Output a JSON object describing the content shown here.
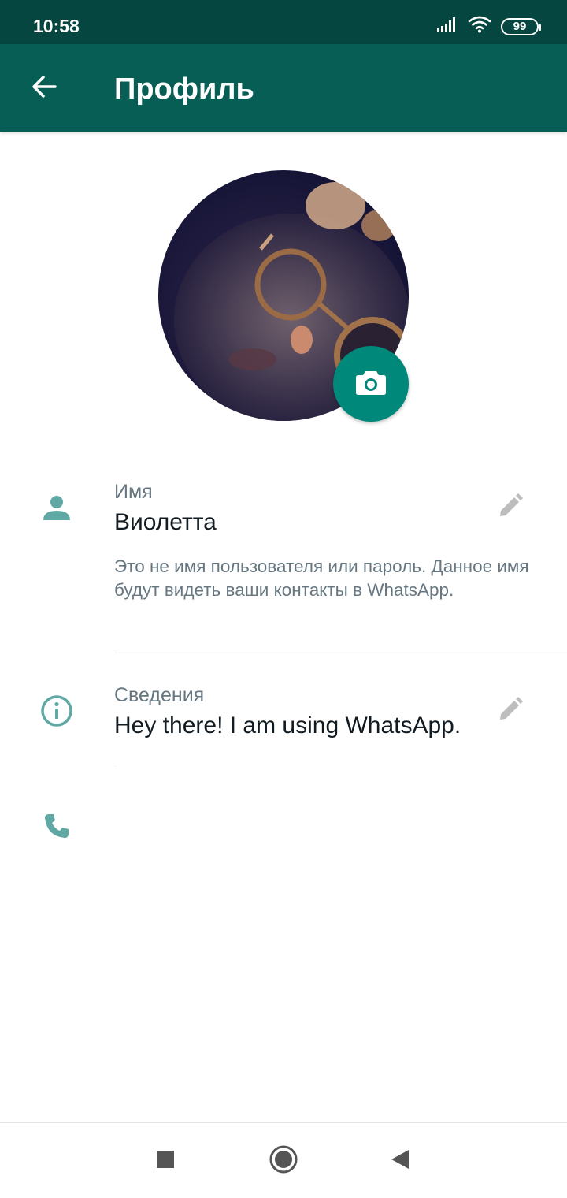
{
  "status_bar": {
    "time": "10:58",
    "battery": "99",
    "signal_icon": "signal-icon",
    "wifi_icon": "wifi-icon"
  },
  "app_bar": {
    "title": "Профиль",
    "back_icon": "arrow-back-icon"
  },
  "profile_photo": {
    "camera_icon": "camera-icon"
  },
  "name_section": {
    "icon": "person-icon",
    "label": "Имя",
    "value": "Виолетта",
    "hint": "Это не имя пользователя или пароль. Данное имя будут видеть ваши контакты в WhatsApp.",
    "edit_icon": "pencil-icon"
  },
  "about_section": {
    "icon": "info-icon",
    "label": "Сведения",
    "value": "Hey there! I am using WhatsApp.",
    "edit_icon": "pencil-icon"
  },
  "phone_section": {
    "icon": "phone-icon"
  },
  "navigation_bar": {
    "recents_icon": "square-icon",
    "home_icon": "circle-icon",
    "back_icon": "triangle-back-icon"
  },
  "colors": {
    "header": "#075e54",
    "status_bar": "#054640",
    "accent": "#00897b",
    "icon_tint": "#5fa8a4"
  }
}
